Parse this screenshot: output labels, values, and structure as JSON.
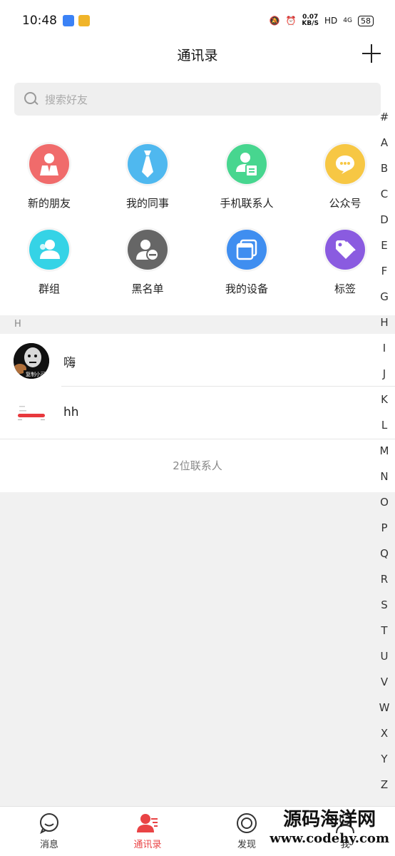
{
  "status": {
    "time": "10:48",
    "speed_top": "0.07",
    "speed_unit": "KB/S",
    "hd": "HD",
    "signal": "4G",
    "battery": "58"
  },
  "header": {
    "title": "通讯录"
  },
  "search": {
    "placeholder": "搜索好友"
  },
  "grid": [
    {
      "label": "新的朋友",
      "icon": "new-friend-icon",
      "color": "#f06b6b"
    },
    {
      "label": "我的同事",
      "icon": "colleague-tie-icon",
      "color": "#4fb8ef"
    },
    {
      "label": "手机联系人",
      "icon": "phone-contacts-icon",
      "color": "#47d68f"
    },
    {
      "label": "公众号",
      "icon": "official-account-icon",
      "color": "#f7c744"
    },
    {
      "label": "群组",
      "icon": "group-icon",
      "color": "#35d3e6"
    },
    {
      "label": "黑名单",
      "icon": "blacklist-icon",
      "color": "#666666"
    },
    {
      "label": "我的设备",
      "icon": "device-icon",
      "color": "#3f8ef0"
    },
    {
      "label": "标签",
      "icon": "tag-icon",
      "color": "#8a5be0"
    }
  ],
  "section": {
    "letter": "H"
  },
  "contacts": [
    {
      "name": "嗨",
      "avatar_caption": "复制小可"
    },
    {
      "name": "hh"
    }
  ],
  "contact_count": "2位联系人",
  "index": [
    "#",
    "A",
    "B",
    "C",
    "D",
    "E",
    "F",
    "G",
    "H",
    "I",
    "J",
    "K",
    "L",
    "M",
    "N",
    "O",
    "P",
    "Q",
    "R",
    "S",
    "T",
    "U",
    "V",
    "W",
    "X",
    "Y",
    "Z"
  ],
  "tabs": [
    {
      "label": "消息",
      "icon": "message-icon",
      "active": false
    },
    {
      "label": "通讯录",
      "icon": "contacts-icon",
      "active": true
    },
    {
      "label": "发现",
      "icon": "discover-icon",
      "active": false
    },
    {
      "label": "我",
      "icon": "me-icon",
      "active": false
    }
  ],
  "watermark": {
    "line1": "源码海洋网",
    "line2": "www.codehy.com"
  },
  "colors": {
    "accent": "#e94345"
  }
}
